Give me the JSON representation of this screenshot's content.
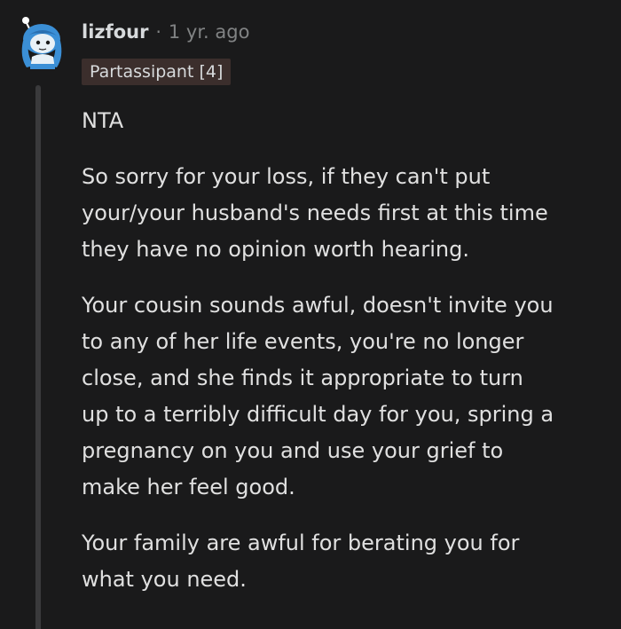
{
  "comment": {
    "username": "lizfour",
    "separator": "·",
    "timestamp": "1 yr. ago",
    "flair": "Partassipant [4]",
    "avatar_icon": "snoo-avatar-icon",
    "colors": {
      "background": "#1a1a1b",
      "flair_background": "#3b2e2c",
      "avatar_blue": "#3b8fd6"
    },
    "paragraphs": [
      {
        "lines": [
          "NTA"
        ]
      },
      {
        "lines": [
          "So sorry for your loss, if they can't put",
          "your/your husband's needs first at this time",
          "they have no opinion worth hearing."
        ]
      },
      {
        "lines": [
          "Your cousin sounds awful, doesn't invite you",
          "to any of her life events, you're no longer",
          "close, and she finds it appropriate to turn",
          "up to a terribly difficult day for you, spring a",
          "pregnancy on you and use your grief to",
          "make her feel good."
        ]
      },
      {
        "lines": [
          "Your family are awful for berating you for",
          "what you need."
        ]
      }
    ]
  }
}
